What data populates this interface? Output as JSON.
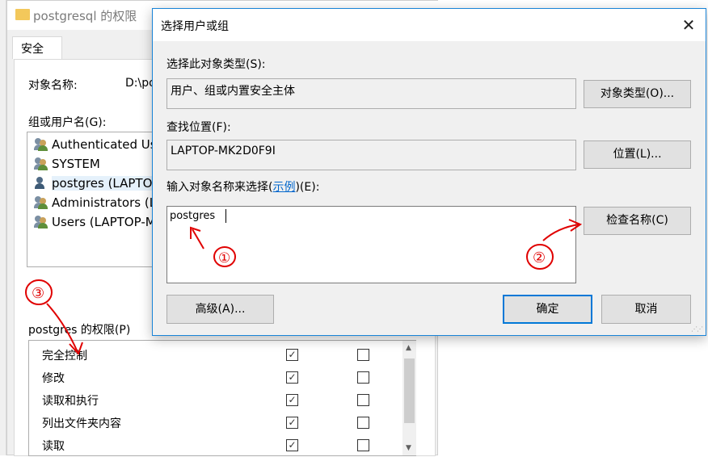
{
  "colors": {
    "accent": "#0078d7",
    "annotation": "#e00000",
    "window_bg": "#f0f0f0"
  },
  "properties_window": {
    "title": "postgresql 的权限",
    "folder_icon": "folder-icon",
    "tab_security": "安全",
    "object_name_label": "对象名称:",
    "object_name_value": "D:\\po",
    "group_label": "组或用户名(G):",
    "users": [
      {
        "name": "Authenticated Us",
        "icon": "users-icon"
      },
      {
        "name": "SYSTEM",
        "icon": "users-icon"
      },
      {
        "name": "postgres (LAPTOP",
        "icon": "user-icon"
      },
      {
        "name": "Administrators (L",
        "icon": "users-icon"
      },
      {
        "name": "Users (LAPTOP-M",
        "icon": "users-icon"
      }
    ],
    "perm_label": "postgres 的权限(P)",
    "permissions": [
      {
        "name": "完全控制",
        "allow": "✓",
        "deny": ""
      },
      {
        "name": "修改",
        "allow": "✓",
        "deny": ""
      },
      {
        "name": "读取和执行",
        "allow": "✓",
        "deny": ""
      },
      {
        "name": "列出文件夹内容",
        "allow": "✓",
        "deny": ""
      },
      {
        "name": "读取",
        "allow": "✓",
        "deny": ""
      }
    ]
  },
  "dialog": {
    "title": "选择用户或组",
    "close_glyph": "✕",
    "object_type_label": "选择此对象类型(S):",
    "object_type_value": "用户、组或内置安全主体",
    "object_type_button": "对象类型(O)...",
    "location_label": "查找位置(F):",
    "location_value": "LAPTOP-MK2D0F9I",
    "location_button": "位置(L)...",
    "enter_label_prefix": "输入对象名称来选择(",
    "enter_label_link": "示例",
    "enter_label_suffix": ")(E):",
    "enter_value": "postgres",
    "check_names_button": "检查名称(C)",
    "advanced_button": "高级(A)...",
    "ok_button": "确定",
    "cancel_button": "取消"
  },
  "annotations": [
    "①",
    "②",
    "③"
  ]
}
